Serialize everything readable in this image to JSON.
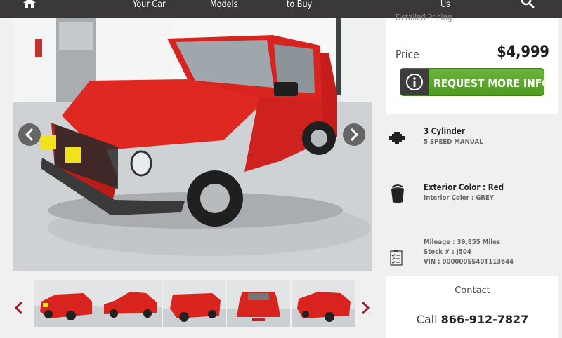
{
  "nav": {
    "home_icon": "home-icon",
    "items": [
      "Your Car",
      "Models",
      "to Buy",
      "Us"
    ],
    "search_icon": "search-icon"
  },
  "gallery": {
    "prev_icon": "chevron-left-icon",
    "next_icon": "chevron-right-icon",
    "thumb_count": 5
  },
  "pricing": {
    "detailed_label": "Detailed Pricing",
    "price_label": "Price",
    "price_value": "$4,999",
    "request_button": "REQUEST MORE INFO",
    "request_icon": "info-icon"
  },
  "specs": {
    "engine": "3 Cylinder",
    "transmission": "5 SPEED MANUAL",
    "exterior": "Exterior Color : Red",
    "interior": "Interior Color : GREY",
    "mileage": "Mileage : 39,855 Miles",
    "stock": "Stock # : J504",
    "vin": "VIN : 000000SS40T113644"
  },
  "contact": {
    "title": "Contact",
    "call_label": "Call",
    "phone": "866-912-7827"
  },
  "colors": {
    "nav_bg": "#3a3838",
    "button_green": "#5aa62b",
    "car_red": "#d8231f",
    "arrow_red": "#a0162a"
  }
}
